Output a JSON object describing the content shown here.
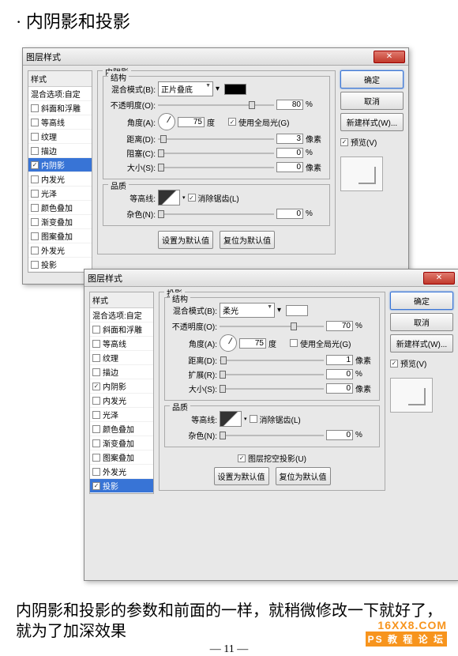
{
  "page": {
    "title": "· 内阴影和投影",
    "caption": "内阴影和投影的参数和前面的一样，就稍微修改一下就好了，就为了加深效果",
    "pagenum": "— 11 —",
    "wm1": "16XX8.COM",
    "wm2": "PS 教 程 论 坛"
  },
  "d1": {
    "title": "图层样式",
    "sidehdr": "样式",
    "blendopt": "混合选项:自定",
    "items": [
      "斜面和浮雕",
      "等高线",
      "纹理",
      "描边",
      "内阴影",
      "内发光",
      "光泽",
      "颜色叠加",
      "渐变叠加",
      "图案叠加",
      "外发光",
      "投影"
    ],
    "checked": [
      4
    ],
    "selected": 4,
    "heading": "内阴影",
    "sect1": "结构",
    "sect2": "品质",
    "rows": {
      "blendmode": "混合模式(B):",
      "blendval": "正片叠底",
      "opacity": "不透明度(O):",
      "opval": "80",
      "pct": "%",
      "angle": "角度(A):",
      "angval": "75",
      "deg": "度",
      "global": "使用全局光(G)",
      "dist": "距离(D):",
      "distval": "3",
      "px": "像素",
      "choke": "阻塞(C):",
      "chokeval": "0",
      "size": "大小(S):",
      "sizeval": "0",
      "contour": "等高线:",
      "anti": "消除锯齿(L)",
      "noise": "杂色(N):",
      "noiseval": "0"
    },
    "btns": {
      "ok": "确定",
      "cancel": "取消",
      "newstyle": "新建样式(W)...",
      "preview": "预览(V)",
      "reset": "设置为默认值",
      "restore": "复位为默认值"
    }
  },
  "d2": {
    "title": "图层样式",
    "sidehdr": "样式",
    "blendopt": "混合选项:自定",
    "items": [
      "斜面和浮雕",
      "等高线",
      "纹理",
      "描边",
      "内阴影",
      "内发光",
      "光泽",
      "颜色叠加",
      "渐变叠加",
      "图案叠加",
      "外发光",
      "投影"
    ],
    "checked": [
      4,
      11
    ],
    "selected": 11,
    "heading": "投影",
    "sect1": "结构",
    "sect2": "品质",
    "rows": {
      "blendmode": "混合模式(B):",
      "blendval": "柔光",
      "opacity": "不透明度(O):",
      "opval": "70",
      "pct": "%",
      "angle": "角度(A):",
      "angval": "75",
      "deg": "度",
      "global": "使用全局光(G)",
      "dist": "距离(D):",
      "distval": "1",
      "px": "像素",
      "spread": "扩展(R):",
      "spreadval": "0",
      "size": "大小(S):",
      "sizeval": "0",
      "contour": "等高线:",
      "anti": "消除锯齿(L)",
      "noise": "杂色(N):",
      "noiseval": "0",
      "knockout": "图层挖空投影(U)"
    },
    "btns": {
      "ok": "确定",
      "cancel": "取消",
      "newstyle": "新建样式(W)...",
      "preview": "预览(V)",
      "reset": "设置为默认值",
      "restore": "复位为默认值"
    }
  }
}
